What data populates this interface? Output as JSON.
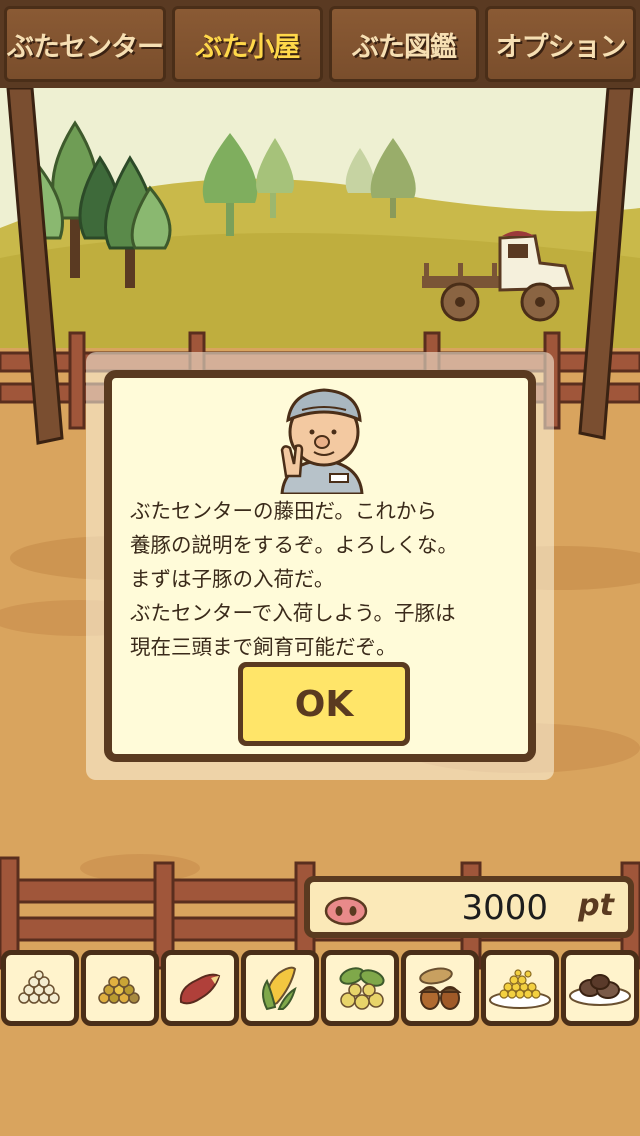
{
  "tabs": [
    {
      "label": "ぶたセンター",
      "active": false
    },
    {
      "label": "ぶた小屋",
      "active": true
    },
    {
      "label": "ぶた図鑑",
      "active": false
    },
    {
      "label": "オプション",
      "active": false
    }
  ],
  "dialog": {
    "speaker_icon": "farmer-portrait",
    "message": "ぶたセンターの藤田だ。これから\n養豚の説明をするぞ。よろしくな。\nまずは子豚の入荷だ。\nぶたセンターで入荷しよう。子豚は\n現在三頭まで飼育可能だぞ。",
    "ok_label": "OK"
  },
  "points": {
    "icon": "pig-nose-icon",
    "value": "3000",
    "unit": "pt"
  },
  "food_items": [
    {
      "icon": "white-grain-icon"
    },
    {
      "icon": "mixed-grain-icon"
    },
    {
      "icon": "sweet-potato-icon"
    },
    {
      "icon": "corn-icon"
    },
    {
      "icon": "soybean-icon"
    },
    {
      "icon": "acorn-icon"
    },
    {
      "icon": "corn-bowl-icon"
    },
    {
      "icon": "meat-dish-icon"
    }
  ]
}
